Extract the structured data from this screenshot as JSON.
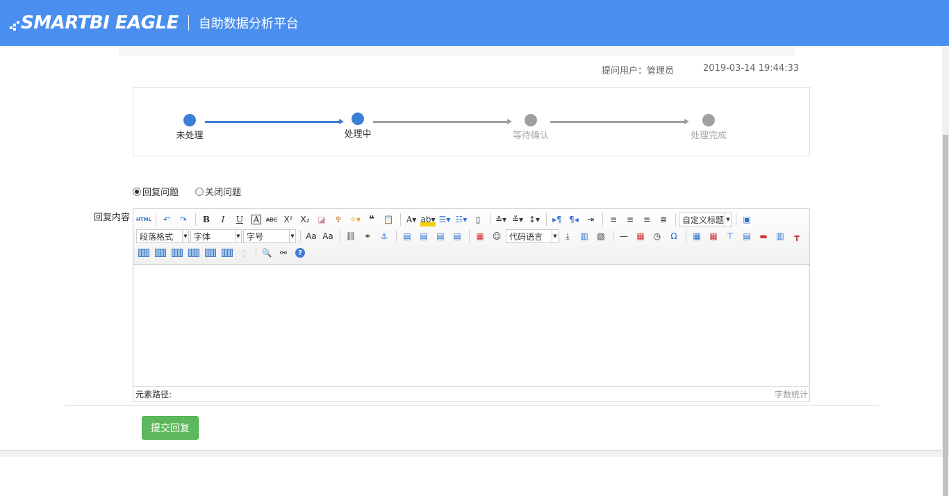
{
  "header": {
    "logo_text": "SMARTBI EAGLE",
    "platform_name": "自助数据分析平台",
    "bg_color": "#4a8ff0"
  },
  "meta": {
    "user": "提问用户：管理员",
    "time": "2019-03-14 19:44:33"
  },
  "steps": [
    {
      "label": "未处理",
      "state": "done"
    },
    {
      "label": "处理中",
      "state": "current"
    },
    {
      "label": "等待确认",
      "state": "pending"
    },
    {
      "label": "处理完成",
      "state": "pending"
    }
  ],
  "colors": {
    "active": "#3d7fd6",
    "inactive": "#a0a0a0",
    "submit": "#5cb85c"
  },
  "radios": [
    {
      "label": "回复问题",
      "checked": true
    },
    {
      "label": "关闭问题",
      "checked": false
    }
  ],
  "editor": {
    "label": "回复内容",
    "custom_heading": "自定义标题",
    "paragraph_format": "段落格式",
    "font_family": "字体",
    "font_size": "字号",
    "code_language": "代码语言",
    "element_path": "元素路径:",
    "word_count": "字数统计",
    "html_button": "HTML"
  },
  "submit_label": "提交回复"
}
